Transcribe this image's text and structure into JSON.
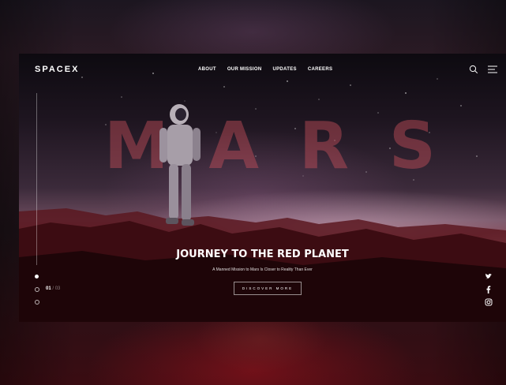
{
  "brand": {
    "logo_text": "SPACEX"
  },
  "nav": {
    "links": [
      "ABOUT",
      "OUR MISSION",
      "UPDATES",
      "CAREERS"
    ]
  },
  "header_icons": [
    "search-icon",
    "menu-icon"
  ],
  "hero": {
    "backdrop_word": [
      "M",
      "A",
      "R",
      "S"
    ],
    "headline": "JOURNEY TO THE RED PLANET",
    "subline": "A Manned Mission to Mars Is Closer to Reality Than Ever",
    "cta_label": "DISCOVER MORE"
  },
  "slider": {
    "current": "01",
    "total": "/ 03",
    "dot_count": 3,
    "active_index": 0
  },
  "social_icons": [
    "twitter-icon",
    "facebook-icon",
    "instagram-icon"
  ],
  "colors": {
    "accent_red": "#c8505a",
    "sky_dark": "#0d0a10",
    "ground_red": "#7a2a36"
  }
}
